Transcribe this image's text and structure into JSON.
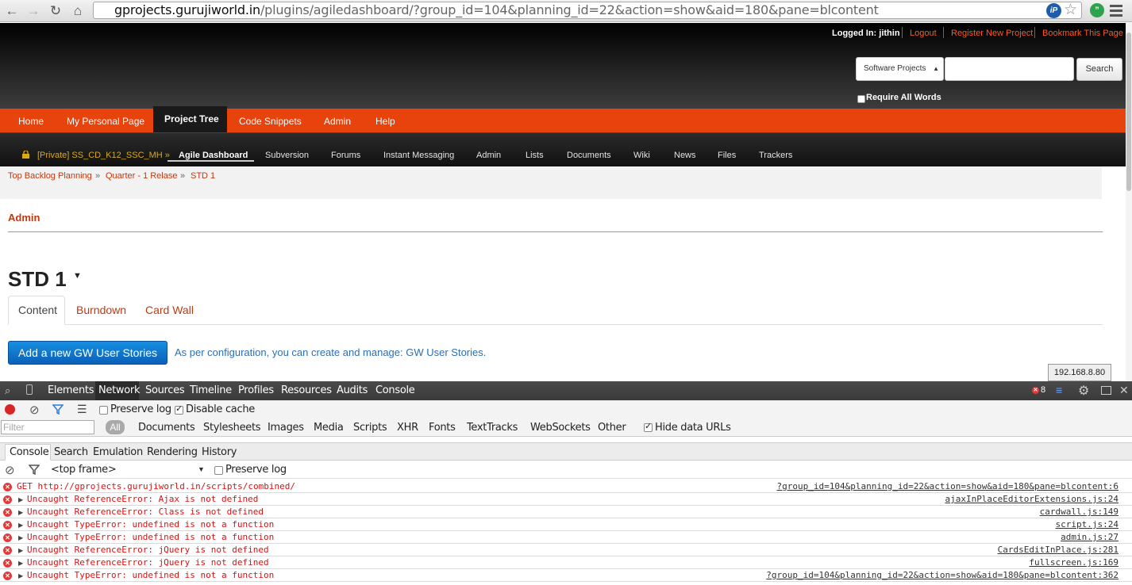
{
  "browser": {
    "url_host": "gprojects.gurujiworld.in",
    "url_path": "/plugins/agiledashboard/?group_id=104&planning_id=22&action=show&aid=180&pane=blcontent",
    "ext_ip_label": "iP"
  },
  "header": {
    "logged_in": "Logged In: jithin",
    "logout": "Logout",
    "register": "Register New Project",
    "bookmark": "Bookmark This Page",
    "search_scope": "Software Projects",
    "search_button": "Search",
    "require_all": "Require All Words"
  },
  "main_nav": {
    "home": "Home",
    "personal": "My Personal Page",
    "project_tree": "Project Tree",
    "snippets": "Code Snippets",
    "admin": "Admin",
    "help": "Help"
  },
  "sub_nav": {
    "project": "[Private] SS_CD_K12_SSC_MH »",
    "agile": "Agile Dashboard",
    "items": [
      "Subversion",
      "Forums",
      "Instant Messaging",
      "Admin",
      "Lists",
      "Documents",
      "Wiki",
      "News",
      "Files",
      "Trackers"
    ]
  },
  "breadcrumb": {
    "c1": "Top Backlog Planning",
    "c2": "Quarter - 1 Relase",
    "c3": "STD 1",
    "sep": "»"
  },
  "page": {
    "admin": "Admin",
    "title": "STD 1",
    "tabs": {
      "content": "Content",
      "burndown": "Burndown",
      "cardwall": "Card Wall"
    },
    "add_button": "Add a new GW User Stories",
    "config_text": "As per configuration, you can create and manage: GW User Stories.",
    "ip_tooltip": "192.168.8.80"
  },
  "devtools": {
    "tabs": [
      "Elements",
      "Network",
      "Sources",
      "Timeline",
      "Profiles",
      "Resources",
      "Audits",
      "Console"
    ],
    "error_count": "8",
    "preserve_log": "Preserve log",
    "disable_cache": "Disable cache",
    "filter_placeholder": "Filter",
    "filter_all": "All",
    "filter_types": [
      "Documents",
      "Stylesheets",
      "Images",
      "Media",
      "Scripts",
      "XHR",
      "Fonts",
      "TextTracks",
      "WebSockets",
      "Other"
    ],
    "hide_data_urls": "Hide data URLs",
    "drawer_tabs": [
      "Console",
      "Search",
      "Emulation",
      "Rendering",
      "History"
    ],
    "frame": "<top frame>",
    "console_preserve": "Preserve log",
    "logs": [
      {
        "msg": "GET http://gprojects.gurujiworld.in/scripts/combined/",
        "src": "?group_id=104&planning_id=22&action=show&aid=180&pane=blcontent:6",
        "expandable": false
      },
      {
        "msg": "Uncaught ReferenceError: Ajax is not defined",
        "src": "ajaxInPlaceEditorExtensions.js:24",
        "expandable": true
      },
      {
        "msg": "Uncaught ReferenceError: Class is not defined",
        "src": "cardwall.js:149",
        "expandable": true
      },
      {
        "msg": "Uncaught TypeError: undefined is not a function",
        "src": "script.js:24",
        "expandable": true
      },
      {
        "msg": "Uncaught TypeError: undefined is not a function",
        "src": "admin.js:27",
        "expandable": true
      },
      {
        "msg": "Uncaught ReferenceError: jQuery is not defined",
        "src": "CardsEditInPlace.js:281",
        "expandable": true
      },
      {
        "msg": "Uncaught ReferenceError: jQuery is not defined",
        "src": "fullscreen.js:169",
        "expandable": true
      },
      {
        "msg": "Uncaught TypeError: undefined is not a function",
        "src": "?group_id=104&planning_id=22&action=show&aid=180&pane=blcontent:362",
        "expandable": true
      }
    ]
  },
  "colors": {
    "accent": "#e8420d",
    "link": "#c3380f",
    "primary_button": "#1a7bd0",
    "error": "#e01010"
  }
}
